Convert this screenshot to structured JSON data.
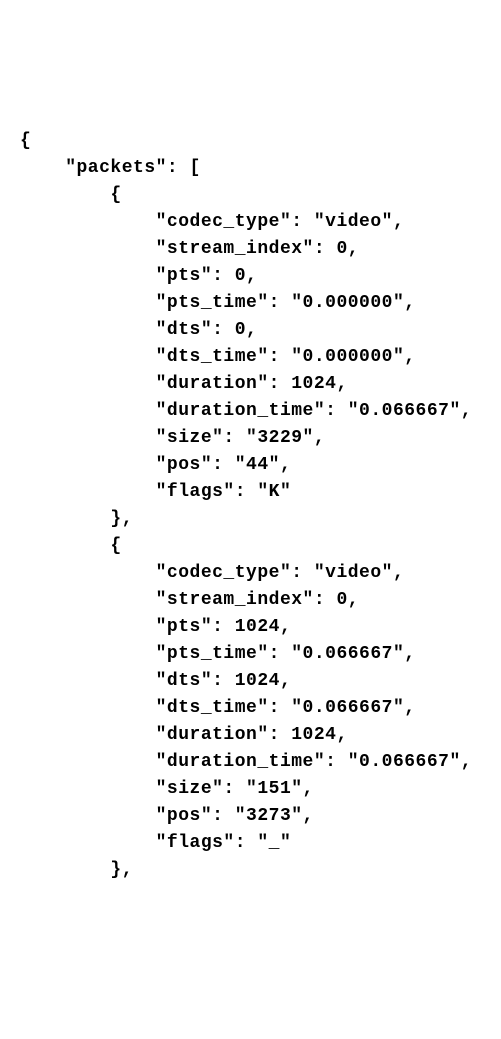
{
  "code": {
    "root_key": "packets",
    "packets": [
      {
        "codec_type": "video",
        "stream_index": 0,
        "pts": 0,
        "pts_time": "0.000000",
        "dts": 0,
        "dts_time": "0.000000",
        "duration": 1024,
        "duration_time": "0.066667",
        "size": "3229",
        "pos": "44",
        "flags": "K"
      },
      {
        "codec_type": "video",
        "stream_index": 0,
        "pts": 1024,
        "pts_time": "0.066667",
        "dts": 1024,
        "dts_time": "0.066667",
        "duration": 1024,
        "duration_time": "0.066667",
        "size": "151",
        "pos": "3273",
        "flags": "_"
      }
    ]
  },
  "lines": {
    "l0": "{",
    "l1": "    \"packets\": [",
    "l2": "        {",
    "l3": "            \"codec_type\": \"video\",",
    "l4": "            \"stream_index\": 0,",
    "l5": "            \"pts\": 0,",
    "l6": "            \"pts_time\": \"0.000000\",",
    "l7": "            \"dts\": 0,",
    "l8": "            \"dts_time\": \"0.000000\",",
    "l9": "            \"duration\": 1024,",
    "l10": "            \"duration_time\": \"0.066667\",",
    "l11": "            \"size\": \"3229\",",
    "l12": "            \"pos\": \"44\",",
    "l13": "            \"flags\": \"K\"",
    "l14": "        },",
    "l15": "        {",
    "l16": "            \"codec_type\": \"video\",",
    "l17": "            \"stream_index\": 0,",
    "l18": "            \"pts\": 1024,",
    "l19": "            \"pts_time\": \"0.066667\",",
    "l20": "            \"dts\": 1024,",
    "l21": "            \"dts_time\": \"0.066667\",",
    "l22": "            \"duration\": 1024,",
    "l23": "            \"duration_time\": \"0.066667\",",
    "l24": "            \"size\": \"151\",",
    "l25": "            \"pos\": \"3273\",",
    "l26": "            \"flags\": \"_\"",
    "l27": "        },"
  }
}
